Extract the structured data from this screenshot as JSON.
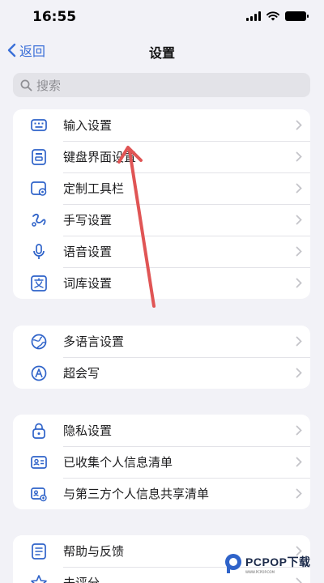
{
  "status_bar": {
    "time": "16:55"
  },
  "nav": {
    "back_label": "返回",
    "title": "设置"
  },
  "search": {
    "placeholder": "搜索"
  },
  "groups": [
    {
      "items": [
        {
          "label": "输入设置",
          "icon": "keyboard-icon"
        },
        {
          "label": "键盘界面设置",
          "icon": "keyboard-layout-icon"
        },
        {
          "label": "定制工具栏",
          "icon": "toolbar-icon"
        },
        {
          "label": "手写设置",
          "icon": "handwriting-icon"
        },
        {
          "label": "语音设置",
          "icon": "microphone-icon"
        },
        {
          "label": "词库设置",
          "icon": "dictionary-icon"
        }
      ]
    },
    {
      "items": [
        {
          "label": "多语言设置",
          "icon": "globe-icon"
        },
        {
          "label": "超会写",
          "icon": "super-write-icon"
        }
      ]
    },
    {
      "items": [
        {
          "label": "隐私设置",
          "icon": "lock-icon"
        },
        {
          "label": "已收集个人信息清单",
          "icon": "id-card-icon"
        },
        {
          "label": "与第三方个人信息共享清单",
          "icon": "share-card-icon"
        }
      ]
    },
    {
      "items": [
        {
          "label": "帮助与反馈",
          "icon": "help-icon"
        },
        {
          "label": "去评分",
          "icon": "star-icon"
        }
      ]
    }
  ],
  "watermark": {
    "text": "PCPOP下载",
    "subtext": "WWW.PCPOP.COM"
  },
  "colors": {
    "accent": "#3a6fd8",
    "icon": "#2f63c9",
    "arrow": "#e05555",
    "background": "#f2f2f7"
  }
}
